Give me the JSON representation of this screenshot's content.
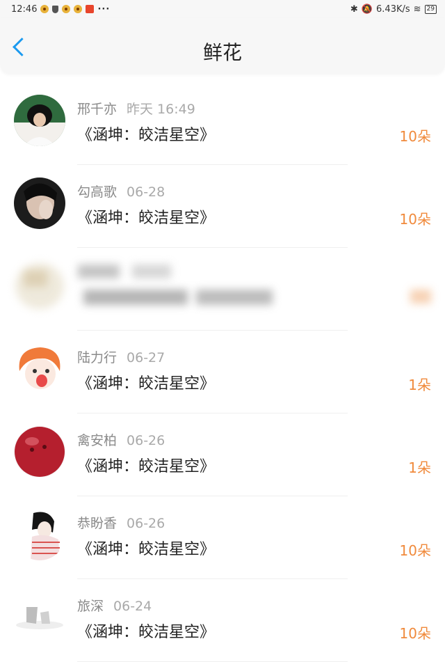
{
  "status": {
    "time": "12:46",
    "dots": "···",
    "speed": "6.43K/s",
    "battery": "29"
  },
  "nav": {
    "title": "鲜花"
  },
  "items": [
    {
      "name": "邢千亦",
      "date": "昨天 16:49",
      "book": "《涵坤：皎洁星空》",
      "count": "10朵"
    },
    {
      "name": "勾高歌",
      "date": "06-28",
      "book": "《涵坤：皎洁星空》",
      "count": "10朵"
    },
    {
      "name": "",
      "date": "",
      "book": "",
      "count": ""
    },
    {
      "name": "陆力行",
      "date": "06-27",
      "book": "《涵坤：皎洁星空》",
      "count": "1朵"
    },
    {
      "name": "禽安柏",
      "date": "06-26",
      "book": "《涵坤：皎洁星空》",
      "count": "1朵"
    },
    {
      "name": "恭盼香",
      "date": "06-26",
      "book": "《涵坤：皎洁星空》",
      "count": "10朵"
    },
    {
      "name": "旅深",
      "date": "06-24",
      "book": "《涵坤：皎洁星空》",
      "count": "10朵"
    }
  ],
  "colors": {
    "accent": "#1b9aef",
    "count": "#f08a3c"
  }
}
